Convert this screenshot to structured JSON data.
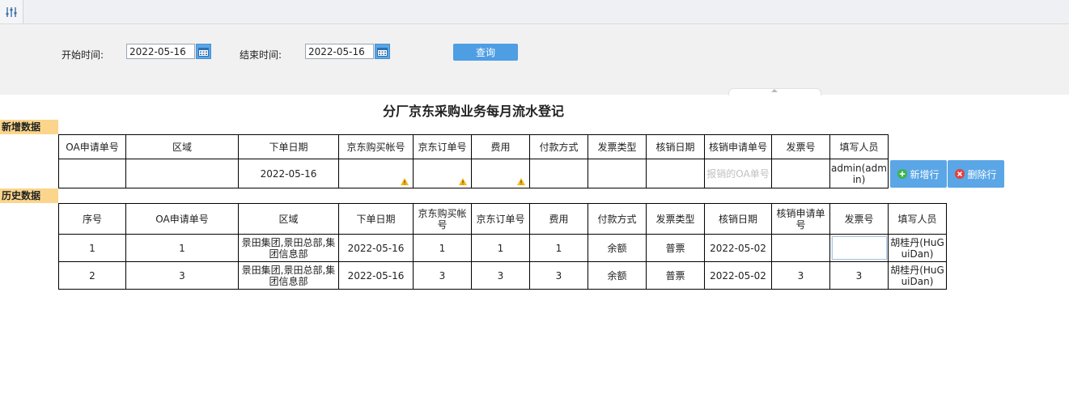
{
  "toolbar": {
    "filter_icon": "sliders-icon"
  },
  "search": {
    "start_label": "开始时间:",
    "start_value": "2022-05-16",
    "end_label": "结束时间:",
    "end_value": "2022-05-16",
    "query_label": "查询"
  },
  "title": "分厂京东采购业务每月流水登记",
  "new_section": {
    "label": "新增数据",
    "headers": [
      "OA申请单号",
      "区域",
      "下单日期",
      "京东购买帐号",
      "京东订单号",
      "费用",
      "付款方式",
      "发票类型",
      "核销日期",
      "核销申请单号",
      "发票号",
      "填写人员"
    ],
    "row": {
      "oa_no": "",
      "area": "",
      "order_date": "2022-05-16",
      "jd_account": "",
      "jd_order": "",
      "fee": "",
      "pay_method": "",
      "invoice_type": "",
      "writeoff_date": "",
      "writeoff_no_placeholder": "报销的OA单号",
      "invoice_no": "",
      "filler": "admin(admin)"
    },
    "add_row_label": "新增行",
    "delete_row_label": "删除行"
  },
  "history_section": {
    "label": "历史数据",
    "headers": [
      "序号",
      "OA申请单号",
      "区域",
      "下单日期",
      "京东购买帐号",
      "京东订单号",
      "费用",
      "付款方式",
      "发票类型",
      "核销日期",
      "核销申请单号",
      "发票号",
      "填写人员"
    ],
    "rows": [
      [
        "1",
        "1",
        "景田集团,景田总部,集团信息部",
        "2022-05-16",
        "1",
        "1",
        "1",
        "余额",
        "普票",
        "2022-05-02",
        "",
        "",
        "胡桂丹(HuGuiDan)"
      ],
      [
        "2",
        "3",
        "景田集团,景田总部,集团信息部",
        "2022-05-16",
        "3",
        "3",
        "3",
        "余额",
        "普票",
        "2022-05-02",
        "3",
        "3",
        "胡桂丹(HuGuiDan)"
      ]
    ]
  },
  "colors": {
    "accent": "#4e9ee4",
    "section_label_bg": "#fad58b",
    "add_icon": "#3bb54a",
    "delete_icon": "#e2413b",
    "warn_icon": "#f2b81c"
  }
}
